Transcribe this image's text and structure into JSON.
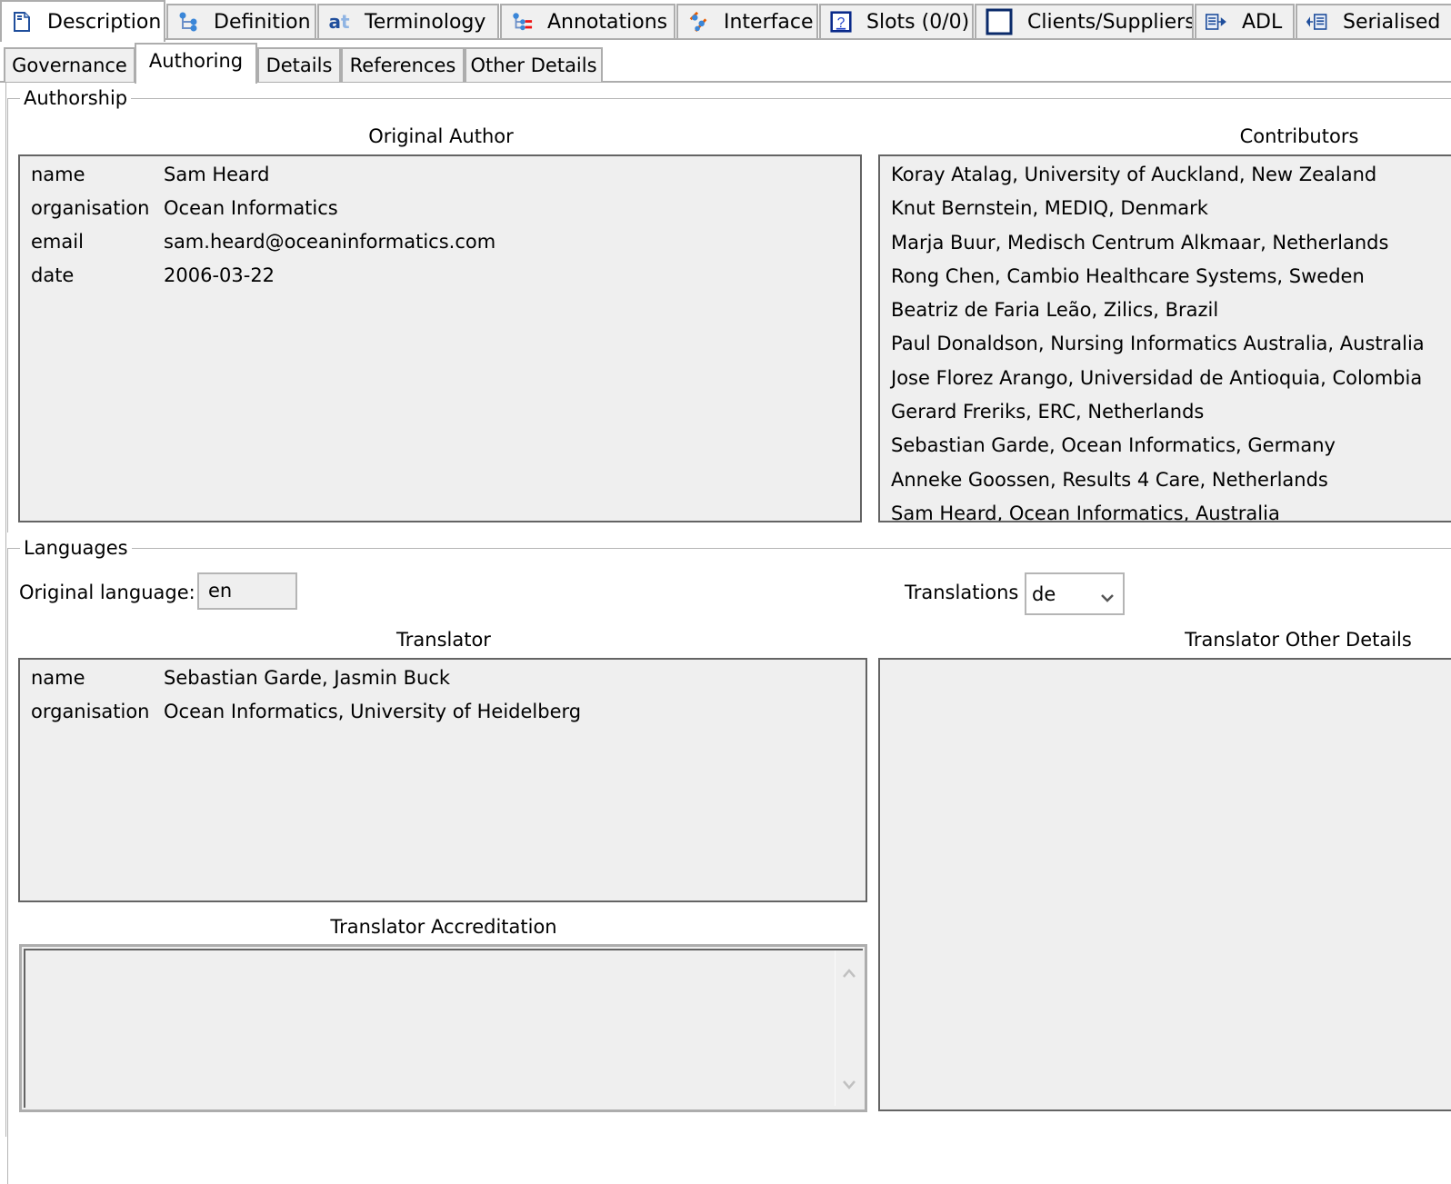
{
  "top_tabs": [
    {
      "label": "Description",
      "icon": "description-page-icon",
      "active": true
    },
    {
      "label": "Definition",
      "icon": "definition-tree-icon",
      "active": false
    },
    {
      "label": "Terminology",
      "icon": "terminology-at-icon",
      "active": false
    },
    {
      "label": "Annotations",
      "icon": "annotations-tree-icon",
      "active": false
    },
    {
      "label": "Interface",
      "icon": "interface-icon",
      "active": false
    },
    {
      "label": "Slots (0/0)",
      "icon": "slots-question-icon",
      "active": false
    },
    {
      "label": "Clients/Suppliers",
      "icon": "clients-suppliers-icon",
      "active": false
    },
    {
      "label": "ADL",
      "icon": "adl-export-icon",
      "active": false
    },
    {
      "label": "Serialised",
      "icon": "serialised-import-icon",
      "active": false
    }
  ],
  "sub_tabs": [
    {
      "label": "Governance",
      "active": false
    },
    {
      "label": "Authoring",
      "active": true
    },
    {
      "label": "Details",
      "active": false
    },
    {
      "label": "References",
      "active": false
    },
    {
      "label": "Other Details",
      "active": false
    }
  ],
  "authorship": {
    "title": "Authorship",
    "original_author": {
      "header": "Original Author",
      "rows": [
        {
          "key": "name",
          "value": "Sam Heard"
        },
        {
          "key": "organisation",
          "value": "Ocean Informatics"
        },
        {
          "key": "email",
          "value": "sam.heard@oceaninformatics.com"
        },
        {
          "key": "date",
          "value": "2006-03-22"
        }
      ]
    },
    "contributors": {
      "header": "Contributors",
      "items": [
        "Koray Atalag, University of Auckland, New Zealand",
        "Knut Bernstein, MEDIQ, Denmark",
        "Marja Buur, Medisch Centrum Alkmaar, Netherlands",
        "Rong Chen, Cambio Healthcare Systems, Sweden",
        "Beatriz de Faria Leão, Zilics, Brazil",
        "Paul Donaldson, Nursing Informatics Australia, Australia",
        "Jose Florez Arango, Universidad de Antioquia, Colombia",
        "Gerard Freriks, ERC, Netherlands",
        "Sebastian Garde, Ocean Informatics, Germany",
        "Anneke Goossen, Results 4 Care, Netherlands",
        "Sam Heard, Ocean Informatics, Australia"
      ]
    }
  },
  "languages": {
    "title": "Languages",
    "original_language_label": "Original language:",
    "original_language_value": "en",
    "translations_label": "Translations",
    "translations_selected": "de",
    "translator": {
      "header": "Translator",
      "rows": [
        {
          "key": "name",
          "value": "Sebastian Garde, Jasmin Buck"
        },
        {
          "key": "organisation",
          "value": "Ocean Informatics, University of Heidelberg"
        }
      ]
    },
    "translator_other_details_header": "Translator Other Details",
    "translator_accreditation_header": "Translator Accreditation",
    "translator_accreditation_value": ""
  }
}
